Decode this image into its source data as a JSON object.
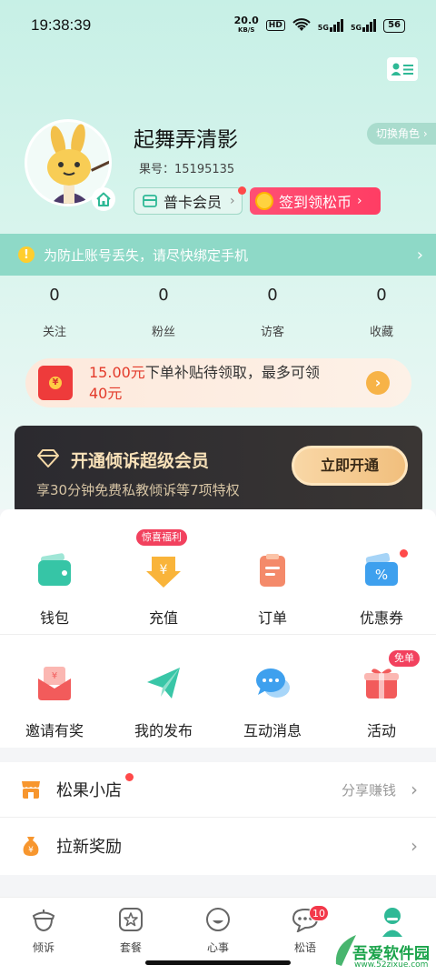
{
  "status_bar": {
    "time": "19:38:39",
    "net_speed": "20.0",
    "net_unit": "KB/S",
    "hd": "HD",
    "signal1": "5G",
    "signal2": "5G",
    "battery": "56"
  },
  "profile": {
    "nickname": "起舞弄清影",
    "user_id": "果号：15195135",
    "switch_role": "切换角色",
    "member_label": "普卡会员",
    "checkin_label": "签到领松币"
  },
  "notice": {
    "text": "为防止账号丢失，请尽快绑定手机"
  },
  "stats": [
    {
      "value": "0",
      "label": "关注"
    },
    {
      "value": "0",
      "label": "粉丝"
    },
    {
      "value": "0",
      "label": "访客"
    },
    {
      "value": "0",
      "label": "收藏"
    }
  ],
  "subsidy": {
    "amount": "15.00元",
    "text_mid": "下单补贴待领取，最多可领",
    "max": "40元"
  },
  "vip": {
    "title": "开通倾诉超级会员",
    "subtitle": "享30分钟免费私教倾诉等7项特权",
    "button": "立即开通"
  },
  "grid_row1": [
    {
      "label": "钱包",
      "icon": "wallet-icon"
    },
    {
      "label": "充值",
      "icon": "recharge-icon",
      "tag": "惊喜福利"
    },
    {
      "label": "订单",
      "icon": "order-icon"
    },
    {
      "label": "优惠券",
      "icon": "coupon-icon"
    }
  ],
  "grid_row2": [
    {
      "label": "邀请有奖",
      "icon": "invite-icon"
    },
    {
      "label": "我的发布",
      "icon": "publish-icon"
    },
    {
      "label": "互动消息",
      "icon": "message-icon"
    },
    {
      "label": "活动",
      "icon": "gift-icon",
      "tag": "免单"
    }
  ],
  "list": {
    "shop_label": "松果小店",
    "shop_extra": "分享赚钱",
    "reward_label": "拉新奖励"
  },
  "tabbar": [
    {
      "label": "倾诉"
    },
    {
      "label": "套餐"
    },
    {
      "label": "心事"
    },
    {
      "label": "松语",
      "badge": "10"
    },
    {
      "label": ""
    }
  ],
  "watermark": {
    "name": "吾爱软件园",
    "url": "www.52zixue.com"
  },
  "colors": {
    "accent": "#3cc3a6",
    "notice_bg": "#8ed9c7",
    "red": "#f3384a",
    "vip_gold": "#f1bf7d"
  }
}
